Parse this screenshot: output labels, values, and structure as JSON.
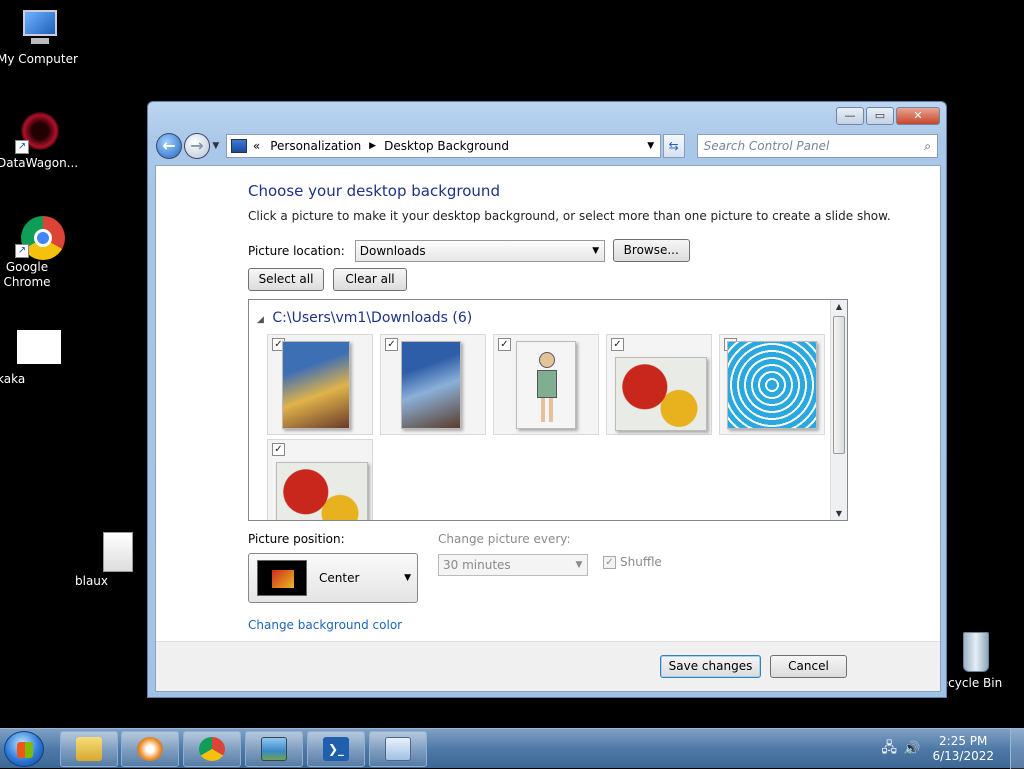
{
  "desktop": {
    "icons": [
      {
        "label": "My Computer"
      },
      {
        "label": "DataWagon..."
      },
      {
        "label": "Google Chrome"
      },
      {
        "label": "kaka"
      },
      {
        "label": "blaux"
      },
      {
        "label": "Recycle Bin"
      }
    ]
  },
  "window": {
    "breadcrumb": [
      "Personalization",
      "Desktop Background"
    ],
    "breadcrumb_prefix": "«",
    "search_placeholder": "Search Control Panel",
    "caption": {
      "minimize": "—",
      "maximize": "▭",
      "close": "✕"
    },
    "heading": "Choose your desktop background",
    "subtext": "Click a picture to make it your desktop background, or select more than one picture to create a slide show.",
    "picture_location_label": "Picture location:",
    "picture_location_value": "Downloads",
    "browse_label": "Browse...",
    "select_all_label": "Select all",
    "clear_all_label": "Clear all",
    "group_header": "C:\\Users\\vm1\\Downloads (6)",
    "thumbnails": [
      {
        "name": "blue-peter-1",
        "checked": true,
        "colors": [
          "#3d6fb5",
          "#e0b34a"
        ]
      },
      {
        "name": "blue-peter-2",
        "checked": true,
        "colors": [
          "#2f5ea8",
          "#8bb0d8"
        ]
      },
      {
        "name": "cartoon-character",
        "checked": true,
        "colors": [
          "#f5f5f5",
          "#7fae90"
        ]
      },
      {
        "name": "flowers-1",
        "checked": true,
        "colors": [
          "#c9261c",
          "#e8b21e"
        ]
      },
      {
        "name": "blue-circles",
        "checked": true,
        "colors": [
          "#2aa9e0",
          "#0a3a78"
        ]
      },
      {
        "name": "flowers-2",
        "checked": true,
        "colors": [
          "#c9261c",
          "#e8b21e"
        ]
      }
    ],
    "picture_position_label": "Picture position:",
    "picture_position_value": "Center",
    "change_every_label": "Change picture every:",
    "change_every_value": "30 minutes",
    "shuffle_label": "Shuffle",
    "change_bg_color_link": "Change background color",
    "save_label": "Save changes",
    "cancel_label": "Cancel"
  },
  "taskbar": {
    "time": "2:25 PM",
    "date": "6/13/2022"
  }
}
